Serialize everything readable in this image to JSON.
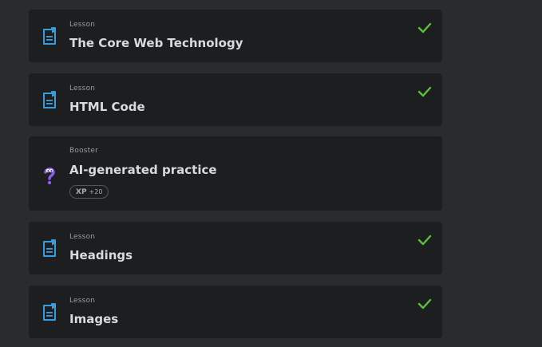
{
  "items": [
    {
      "kind": "Lesson",
      "title": "The Core Web Technology",
      "icon": "lesson-document-icon",
      "completed": true
    },
    {
      "kind": "Lesson",
      "title": "HTML Code",
      "icon": "lesson-document-icon",
      "completed": true
    },
    {
      "kind": "Booster",
      "title": "AI-generated practice",
      "icon": "question-mark-character-icon",
      "completed": false,
      "xp_label": "XP",
      "xp_value": "+20"
    },
    {
      "kind": "Lesson",
      "title": "Headings",
      "icon": "lesson-document-icon",
      "completed": true
    },
    {
      "kind": "Lesson",
      "title": "Images",
      "icon": "lesson-document-icon",
      "completed": true
    }
  ],
  "colors": {
    "lesson_icon": "#3a9ce0",
    "booster_icon": "#8b5cf6",
    "check": "#5bc236",
    "card_bg": "#1d1e20",
    "page_bg": "#2a2b2d"
  }
}
